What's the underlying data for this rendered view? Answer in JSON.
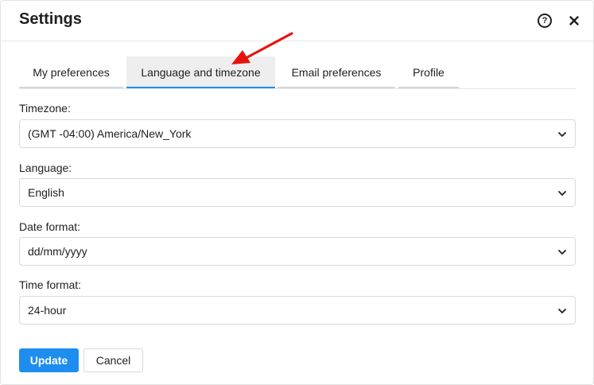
{
  "dialog": {
    "title": "Settings",
    "help_icon": "question-circle-icon",
    "close_icon": "close-icon"
  },
  "tabs": [
    {
      "label": "My preferences",
      "active": false
    },
    {
      "label": "Language and timezone",
      "active": true
    },
    {
      "label": "Email preferences",
      "active": false
    },
    {
      "label": "Profile",
      "active": false
    }
  ],
  "fields": {
    "timezone": {
      "label": "Timezone:",
      "value": "(GMT -04:00) America/New_York"
    },
    "language": {
      "label": "Language:",
      "value": "English"
    },
    "date_format": {
      "label": "Date format:",
      "value": "dd/mm/yyyy"
    },
    "time_format": {
      "label": "Time format:",
      "value": "24-hour"
    }
  },
  "actions": {
    "update_label": "Update",
    "cancel_label": "Cancel"
  },
  "annotation": {
    "arrow_color": "#e8120c"
  },
  "colors": {
    "accent": "#1d8ef0",
    "active_tab_bg": "#eeeeee"
  }
}
